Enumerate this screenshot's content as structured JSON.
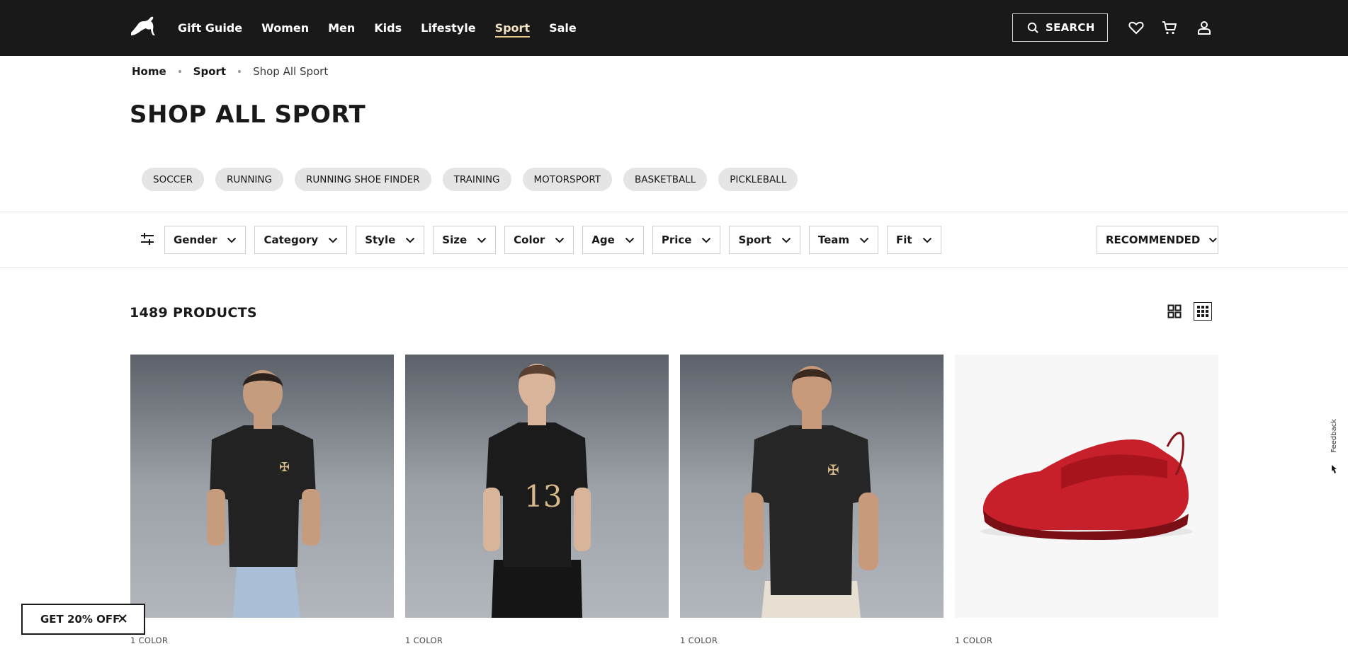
{
  "header": {
    "nav": [
      "Gift Guide",
      "Women",
      "Men",
      "Kids",
      "Lifestyle",
      "Sport",
      "Sale"
    ],
    "active_nav": "Sport",
    "search_label": "SEARCH"
  },
  "breadcrumb": {
    "home": "Home",
    "section": "Sport",
    "current": "Shop All Sport"
  },
  "page_title": "SHOP ALL SPORT",
  "categories": [
    "SOCCER",
    "RUNNING",
    "RUNNING SHOE FINDER",
    "TRAINING",
    "MOTORSPORT",
    "BASKETBALL",
    "PICKLEBALL"
  ],
  "filters": [
    "Gender",
    "Category",
    "Style",
    "Size",
    "Color",
    "Age",
    "Price",
    "Sport",
    "Team",
    "Fit"
  ],
  "sort_label": "RECOMMENDED",
  "product_count": "1489 PRODUCTS",
  "products": [
    {
      "colors": "1 COLOR"
    },
    {
      "colors": "1 COLOR"
    },
    {
      "colors": "1 COLOR"
    },
    {
      "colors": "1 COLOR"
    }
  ],
  "promo": {
    "label": "GET 20% OFF"
  },
  "feedback_label": "Feedback",
  "colors": {
    "header_bg": "#191919",
    "active_underline": "#e8c98a",
    "pill_bg": "#e5e5e5",
    "shoe_red": "#c8202a"
  }
}
